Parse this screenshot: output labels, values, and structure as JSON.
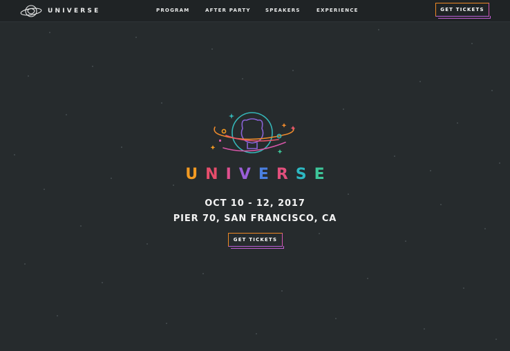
{
  "nav": {
    "brand": "UNIVERSE",
    "brand_icon": "universe-logo-icon",
    "items": [
      "PROGRAM",
      "AFTER PARTY",
      "SPEAKERS",
      "EXPERIENCE"
    ],
    "cta_label": "GET TICKETS"
  },
  "hero": {
    "logo_icon": "octocat-planet-icon",
    "title_letters": [
      "U",
      "N",
      "I",
      "V",
      "E",
      "R",
      "S",
      "E"
    ],
    "date": "OCT 10 - 12, 2017",
    "venue": "PIER 70, SAN FRANCISCO, CA",
    "cta_label": "GET TICKETS"
  },
  "colors": {
    "background": "#262b2d",
    "topbar": "#1f2325",
    "title_letters": [
      "#f29a22",
      "#e64d6b",
      "#e0508f",
      "#9a5ed8",
      "#4a7fe0",
      "#e14f7c",
      "#2db8c2",
      "#3ec79a"
    ],
    "button_border": "#f08a24",
    "button_accent": "#c45fd4"
  }
}
